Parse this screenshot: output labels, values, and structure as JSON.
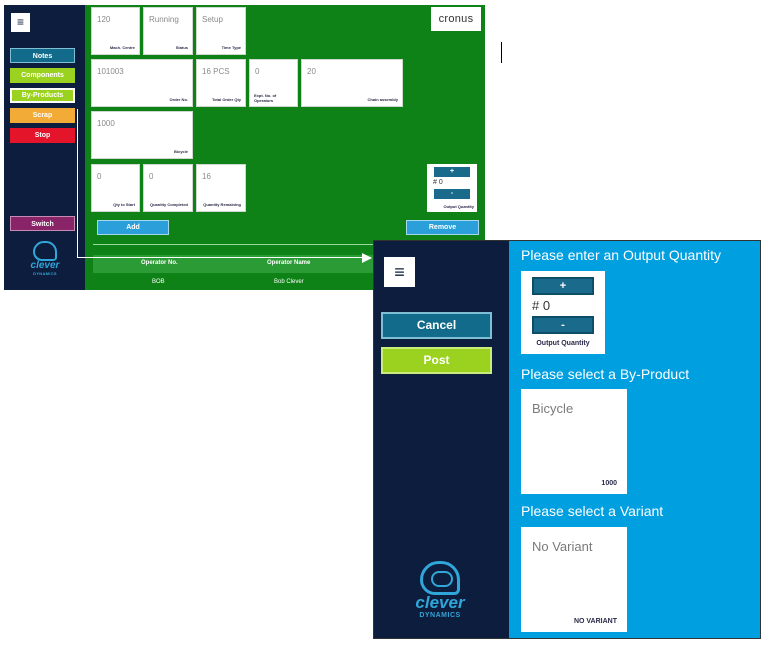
{
  "main": {
    "menu_icon": "≡",
    "sidebar": {
      "notes": "Notes",
      "components": "Components",
      "byproducts": "By-Products",
      "scrap": "Scrap",
      "stop": "Stop",
      "switch": "Switch"
    },
    "logo": {
      "word": "clever",
      "sub": "DYNAMICS"
    },
    "brand": "cronus",
    "fields": {
      "mach_centre": {
        "value": "120",
        "label": "Mach. Centre"
      },
      "status": {
        "value": "Running",
        "label": "Status"
      },
      "time_type": {
        "value": "Setup",
        "label": "Time Type"
      },
      "order_no": {
        "value": "101003",
        "label": "Order No."
      },
      "total_order_qty": {
        "value": "16 PCS",
        "label": "Total Order Qty"
      },
      "expt_operators": {
        "value": "0",
        "label": "Expt. No. of Operators"
      },
      "item": {
        "value": "20",
        "label": "Chain assembly"
      },
      "bicycle": {
        "value": "1000",
        "label": "Bicycle"
      },
      "qty_to_start": {
        "value": "0",
        "label": "Qty to Start"
      },
      "qty_completed": {
        "value": "0",
        "label": "Quantity Completed"
      },
      "qty_remaining": {
        "value": "16",
        "label": "Quantity Remaining"
      }
    },
    "output": {
      "plus": "+",
      "minus": "-",
      "hash": "#",
      "value": "0",
      "label": "Output Quantity"
    },
    "add": "Add",
    "remove": "Remove",
    "table": {
      "col_operator_no": "Operator No.",
      "col_operator_name": "Operator Name",
      "rows": [
        {
          "operator_no": "BOB",
          "operator_name": "Bob Clever"
        }
      ]
    }
  },
  "dialog": {
    "menu_icon": "≡",
    "cancel": "Cancel",
    "post": "Post",
    "logo": {
      "word": "clever",
      "sub": "DYNAMICS"
    },
    "heading_output": "Please enter an Output Quantity",
    "output": {
      "plus": "+",
      "minus": "-",
      "hash": "#",
      "value": "0",
      "label": "Output Quantity"
    },
    "heading_byproduct": "Please select a By-Product",
    "byproduct": {
      "name": "Bicycle",
      "code": "1000"
    },
    "heading_variant": "Please select a Variant",
    "variant": {
      "name": "No Variant",
      "code": "NO VARIANT"
    }
  }
}
